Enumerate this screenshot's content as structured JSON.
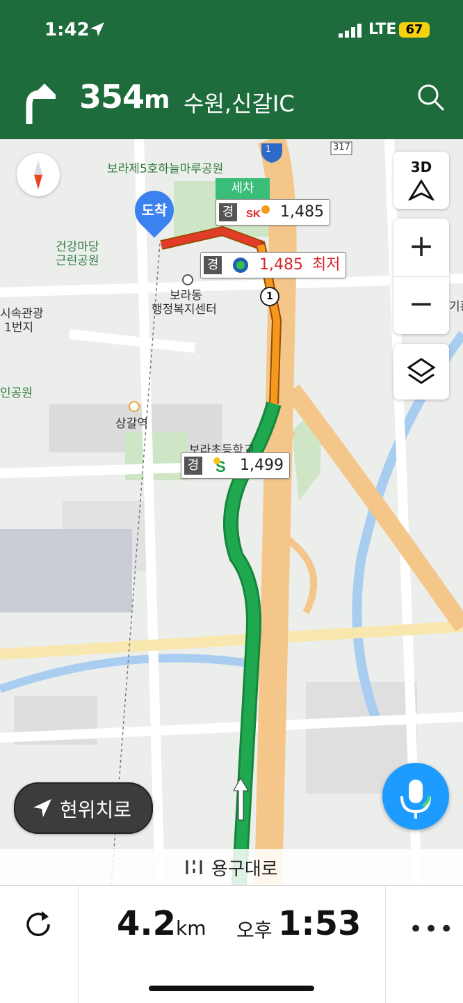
{
  "status_bar": {
    "time": "1:42",
    "network": "LTE",
    "battery": "67"
  },
  "guidance": {
    "turn_icon": "turn-right-arrow-icon",
    "distance_value": "354",
    "distance_unit": "m",
    "destination": "수원,신갈IC"
  },
  "map": {
    "labels": {
      "park_top": "보라제5호하늘마루공원",
      "park_left_line1": "건강마당",
      "park_left_line2": "근린공원",
      "office_line1": "보라동",
      "office_line2": "행정복지센터",
      "station": "상갈역",
      "school": "보라초등학교",
      "left_edge_1": "시속관광",
      "left_edge_2": "1번지",
      "left_edge_3": "인공원",
      "right_edge": "기흥",
      "highway_shield": "317",
      "route_shield": "1"
    },
    "three_d_label": "3D",
    "zoom_in": "+",
    "zoom_out": "−",
    "arrival_label": "도착",
    "carwash_label": "세차",
    "waypoint_number": "1",
    "gas_stations": [
      {
        "kind": "경",
        "brand": "SK",
        "price": "1,485",
        "note": ""
      },
      {
        "kind": "경",
        "brand": "HD",
        "price": "1,485",
        "note": "최저"
      },
      {
        "kind": "경",
        "brand": "S-OIL",
        "price": "1,499",
        "note": ""
      }
    ]
  },
  "current_location_button": "현위치로",
  "current_road": "용구대로",
  "summary": {
    "remaining_value": "4.2",
    "remaining_unit": "km",
    "eta_prefix": "오후",
    "eta_time": "1:53",
    "more": "•••"
  },
  "colors": {
    "header": "#1e6b3c",
    "route_green": "#1fa84f",
    "route_orange": "#f39a1e",
    "route_red": "#e23b2a",
    "accent_blue": "#1e9bff"
  }
}
